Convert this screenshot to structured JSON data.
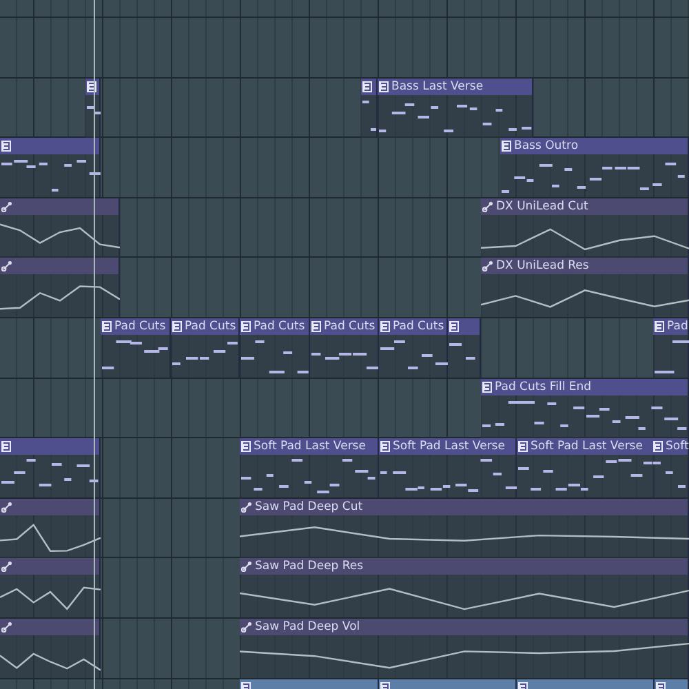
{
  "tracks": [
    {
      "clips": [
        {
          "kind": "pattern"
        },
        {
          "kind": "pattern"
        },
        {
          "kind": "pattern",
          "label": "Bass Last Verse"
        }
      ]
    },
    {
      "clips": [
        {
          "kind": "pattern"
        },
        {
          "kind": "pattern",
          "label": "Bass Outro"
        }
      ]
    },
    {
      "clips": [
        {
          "kind": "automation"
        },
        {
          "kind": "automation",
          "label": "DX UniLead Cut"
        }
      ]
    },
    {
      "clips": [
        {
          "kind": "automation"
        },
        {
          "kind": "automation",
          "label": "DX UniLead Res"
        }
      ]
    },
    {
      "clips": [
        {
          "kind": "pattern",
          "label": "Pad Cuts"
        },
        {
          "kind": "pattern",
          "label": "Pad Cuts"
        },
        {
          "kind": "pattern",
          "label": "Pad Cuts"
        },
        {
          "kind": "pattern",
          "label": "Pad Cuts"
        },
        {
          "kind": "pattern",
          "label": "Pad Cuts"
        },
        {
          "kind": "pattern"
        },
        {
          "kind": "pattern",
          "label": "Pad"
        }
      ]
    },
    {
      "clips": [
        {
          "kind": "pattern",
          "label": "Pad Cuts Fill End"
        }
      ]
    },
    {
      "clips": [
        {
          "kind": "pattern"
        },
        {
          "kind": "pattern",
          "label": "Soft Pad Last Verse"
        },
        {
          "kind": "pattern",
          "label": "Soft Pad Last Verse"
        },
        {
          "kind": "pattern",
          "label": "Soft Pad Last Verse"
        },
        {
          "kind": "pattern",
          "label": "Soft"
        }
      ]
    },
    {
      "clips": [
        {
          "kind": "automation"
        },
        {
          "kind": "automation",
          "label": "Saw Pad Deep Cut"
        }
      ]
    },
    {
      "clips": [
        {
          "kind": "automation"
        },
        {
          "kind": "automation",
          "label": "Saw Pad Deep Res"
        }
      ]
    },
    {
      "clips": [
        {
          "kind": "automation"
        },
        {
          "kind": "automation",
          "label": "Saw Pad Deep Vol"
        }
      ]
    },
    {
      "clips": [
        {
          "kind": "pattern"
        },
        {
          "kind": "pattern"
        },
        {
          "kind": "pattern"
        },
        {
          "kind": "pattern"
        }
      ]
    }
  ]
}
